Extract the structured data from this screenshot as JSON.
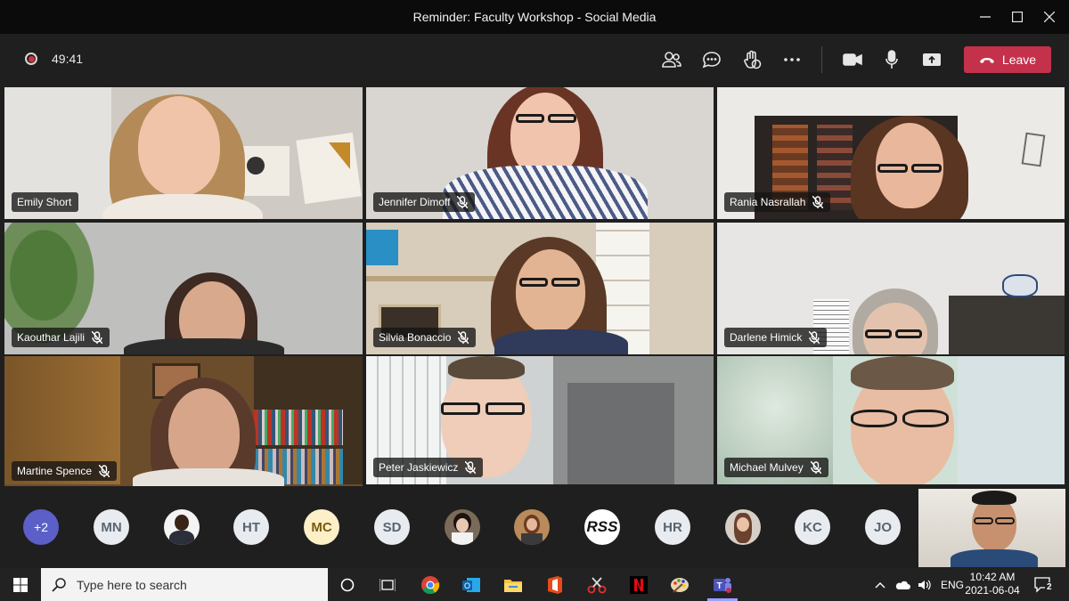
{
  "window": {
    "title": "Reminder: Faculty Workshop - Social Media"
  },
  "toolbar": {
    "timer": "49:41",
    "leave_label": "Leave"
  },
  "tiles": [
    {
      "name": "Emily Short",
      "muted": false
    },
    {
      "name": "Jennifer Dimoff",
      "muted": true
    },
    {
      "name": "Rania Nasrallah",
      "muted": true
    },
    {
      "name": "Kaouthar Lajili",
      "muted": true
    },
    {
      "name": "Silvia Bonaccio",
      "muted": true
    },
    {
      "name": "Darlene Himick",
      "muted": true
    },
    {
      "name": "Martine Spence",
      "muted": true
    },
    {
      "name": "Peter Jaskiewicz",
      "muted": true
    },
    {
      "name": "Michael Mulvey",
      "muted": true
    }
  ],
  "strip": {
    "more": "+2",
    "initials": [
      "MN",
      "HT",
      "MC",
      "SD",
      "RSS",
      "HR",
      "KC",
      "JO"
    ]
  },
  "taskbar": {
    "search_placeholder": "Type here to search",
    "language": "ENG",
    "time": "10:42 AM",
    "date": "2021-06-04",
    "notification_count": "2"
  },
  "colors": {
    "leave": "#c4314b",
    "more_avatar": "#5b5fc7",
    "mc_avatar": "#fdf0c8"
  }
}
